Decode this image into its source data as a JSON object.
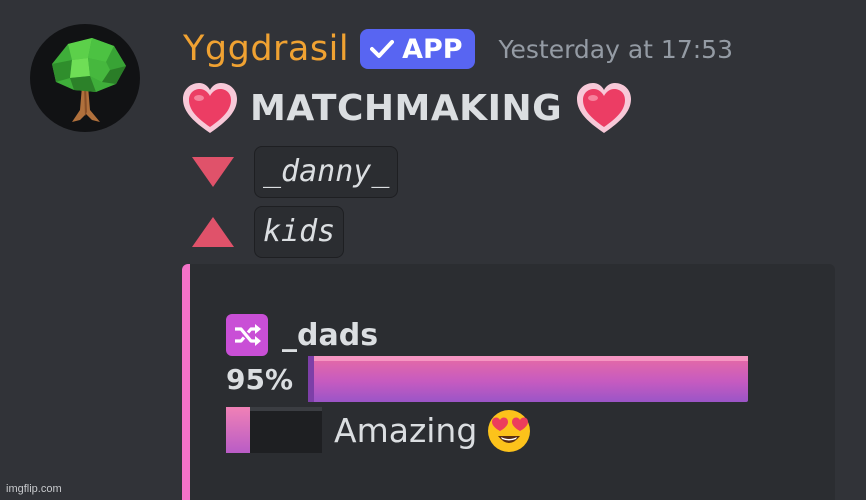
{
  "message": {
    "author": {
      "name": "Yggdrasil",
      "badge_label": "APP",
      "badge_icon": "checkmark-icon",
      "avatar_icon": "tree-icon",
      "name_color": "#f0a232"
    },
    "timestamp": "Yesterday at 17:53",
    "title": "MATCHMAKING",
    "title_icons": [
      "heart-icon",
      "heart-icon"
    ],
    "lower_user": {
      "icon": "triangle-down-icon",
      "name": "_danny_"
    },
    "upper_user": {
      "icon": "triangle-up-icon",
      "name": "kids"
    }
  },
  "embed": {
    "accent_color": "#f472c8",
    "icon": "shuffle-icon",
    "ship_name": "_dads",
    "percent_label": "95%",
    "percent_value": 95,
    "rating_level": 0.25,
    "rating_text": "Amazing",
    "rating_emoji": "heart-eyes-emoji"
  },
  "watermark": "imgflip.com"
}
